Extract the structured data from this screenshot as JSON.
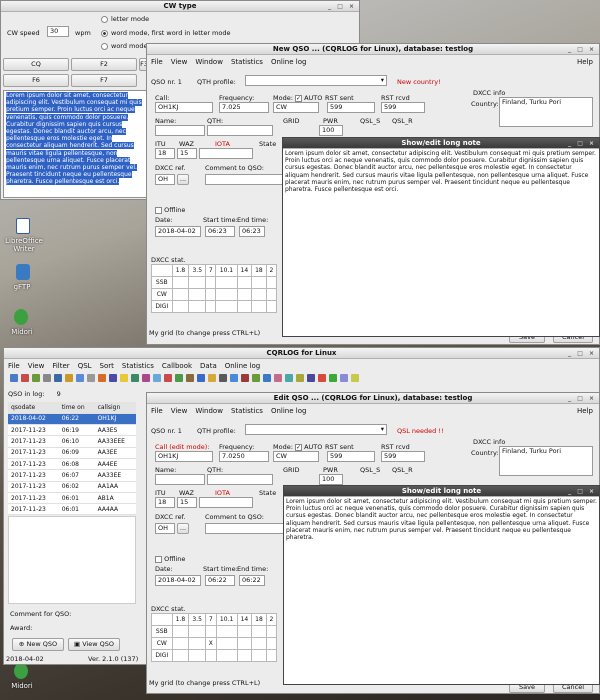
{
  "cwtype": {
    "title": "CW type",
    "speed_label": "CW speed",
    "speed_value": "30",
    "wpm": "wpm",
    "opt1": "letter mode",
    "opt2": "word mode, first word in letter mode",
    "opt3": "word mode",
    "keys": [
      "CQ",
      "F2",
      "F3",
      "F6",
      "F7"
    ],
    "text": "Lorem ipsum dolor sit amet, consectetur adipiscing elit. Vestibulum consequat mi quis pretium semper. Proin luctus orci ac neque venenatis, quis commodo dolor posuere. Curabitur dignissim sapien quis cursus egestas. Donec blandit auctor arcu, nec pellentesque eros molestie eget. In consectetur aliquam hendrerit. Sed cursus mauris vitae ligula pellentesque, non pellentesque urna aliquet. Fusce placerat mauris enim, nec rutrum purus semper vel. Praesent tincidunt neque eu pellentesque pharetra. Fusce pellentesque est orci."
  },
  "desktop": {
    "icons": [
      "LibreOffice Writer",
      "gFTP",
      "Midori",
      "Midori"
    ]
  },
  "newqso": {
    "title": "New QSO ... (CQRLOG for Linux), database: testlog",
    "menu": [
      "File",
      "View",
      "Window",
      "Statistics",
      "Online log",
      "Help"
    ],
    "qso_nr": "QSO nr. 1",
    "qth_profile": "QTH profile:",
    "new_country": "New country!",
    "call_label": "Call:",
    "call": "OH1KJ",
    "freq_label": "Frequency:",
    "freq": "7.025",
    "mode_label": "Mode:",
    "auto": "AUTO",
    "rst_sent_label": "RST sent",
    "rst_rcvd_label": "RST rcvd",
    "mode": "CW",
    "rst_sent": "599",
    "rst_rcvd": "599",
    "name_label": "Name:",
    "qth_label": "QTH:",
    "grid_label": "GRID",
    "pwr_label": "PWR",
    "qsls_label": "QSL_S",
    "qslr_label": "QSL_R",
    "pwr": "100",
    "itu_label": "ITU",
    "waz_label": "WAZ",
    "iota_label": "IOTA",
    "state_label": "State",
    "itu": "18",
    "waz": "15",
    "dxcc_ref_label": "DXCC ref.",
    "comment_label": "Comment to QSO:",
    "dxcc_ref": "OH",
    "offline": "Offline",
    "date_label": "Date:",
    "start_label": "Start time:",
    "end_label": "End time:",
    "date": "2018-04-02",
    "start": "06:23",
    "end": "06:23",
    "dxcc_stat": "DXCC stat.",
    "bands": [
      "1.8",
      "3.5",
      "7",
      "10.1",
      "14",
      "18",
      "2"
    ],
    "rows": [
      "SSB",
      "CW",
      "DIGI"
    ],
    "grid_hint": "My grid (to change press CTRL+L)",
    "dxcc_info_label": "DXCC info",
    "country_label": "Country:",
    "country": "Finland, Turku Pori",
    "save": "Save",
    "cancel": "Cancel"
  },
  "longnote1": {
    "title": "Show/edit long note",
    "text": "Lorem ipsum dolor sit amet, consectetur adipiscing elit. Vestibulum consequat mi quis pretium semper. Proin luctus orci ac neque venenatis, quis commodo dolor posuere. Curabitur dignissim sapien quis cursus egestas. Donec blandit auctor arcu, nec pellentesque eros molestie eget. In consectetur aliquam hendrerit. Sed cursus mauris vitae ligula pellentesque, non pellentesque urna aliquet. Fusce placerat mauris enim, nec rutrum purus semper vel. Praesent tincidunt neque eu pellentesque pharetra. Fusce pellentesque est orci."
  },
  "cqrlog": {
    "title": "CQRLOG for Linux",
    "menu": [
      "File",
      "View",
      "Filter",
      "QSL",
      "Sort",
      "Statistics",
      "Callbook",
      "Data",
      "Online log"
    ],
    "qso_in_log": "QSO in log:",
    "qso_count": "9",
    "columns": [
      "qsodate",
      "time on",
      "callsign"
    ],
    "rows": [
      [
        "2018-04-02",
        "06:22",
        "OH1KJ"
      ],
      [
        "2017-11-23",
        "06:19",
        "AA3ES"
      ],
      [
        "2017-11-23",
        "06:10",
        "AA33EEE"
      ],
      [
        "2017-11-23",
        "06:09",
        "AA3EE"
      ],
      [
        "2017-11-23",
        "06:08",
        "AA4EE"
      ],
      [
        "2017-11-23",
        "06:07",
        "AA33EE"
      ],
      [
        "2017-11-23",
        "06:02",
        "AA1AA"
      ],
      [
        "2017-11-23",
        "06:01",
        "AB1A"
      ],
      [
        "2017-11-23",
        "06:01",
        "AA4AA"
      ]
    ],
    "comment_label": "Comment for QSO:",
    "award_label": "Award:",
    "new_qso": "New QSO",
    "view_qso": "View QSO",
    "status_date": "2018-04-02",
    "version": "Ver. 2.1.0 (137)"
  },
  "editqso": {
    "title": "Edit QSO ... (CQRLOG for Linux), database: testlog",
    "menu": [
      "File",
      "View",
      "Window",
      "Statistics",
      "Online log",
      "Help"
    ],
    "qso_nr": "QSO nr. 1",
    "qth_profile": "QTH profile:",
    "qsl_needed": "QSL needed !!",
    "call_label": "Call (edit mode):",
    "call": "OH1KJ",
    "freq_label": "Frequency:",
    "freq": "7.0250",
    "mode_label": "Mode:",
    "auto": "AUTO",
    "rst_sent_label": "RST sent",
    "rst_rcvd_label": "RST rcvd",
    "mode": "CW",
    "rst_sent": "599",
    "rst_rcvd": "599",
    "name_label": "Name:",
    "qth_label": "QTH:",
    "grid_label": "GRID",
    "pwr_label": "PWR",
    "qsls_label": "QSL_S",
    "qslr_label": "QSL_R",
    "pwr": "100",
    "itu_label": "ITU",
    "waz_label": "WAZ",
    "iota_label": "IOTA",
    "state_label": "State",
    "itu": "18",
    "waz": "15",
    "dxcc_ref_label": "DXCC ref.",
    "comment_label": "Comment to QSO:",
    "dxcc_ref": "OH",
    "offline": "Offline",
    "date_label": "Date:",
    "start_label": "Start time:",
    "end_label": "End time:",
    "date": "2018-04-02",
    "start": "06:22",
    "end": "06:22",
    "dxcc_stat": "DXCC stat.",
    "bands": [
      "1.8",
      "3.5",
      "7",
      "10.1",
      "14",
      "18",
      "2"
    ],
    "rows": [
      "SSB",
      "CW",
      "DIGI"
    ],
    "cw_mark": "X",
    "grid_hint": "My grid (to change press CTRL+L)",
    "dxcc_info_label": "DXCC info",
    "country_label": "Country:",
    "country": "Finland, Turku Pori",
    "save": "Save",
    "cancel": "Cancel"
  },
  "longnote2": {
    "title": "Show/edit long note",
    "text": "Lorem ipsum dolor sit amet, consectetur adipiscing elit. Vestibulum consequat mi quis pretium semper. Proin luctus orci ac neque venenatis, quis commodo dolor posuere. Curabitur dignissim sapien quis cursus egestas. Donec blandit auctor arcu, nec pellentesque eros molestie eget. In consectetur aliquam hendrerit. Sed cursus mauris vitae ligula pellentesque, non pellentesque urna aliquet. Fusce placerat mauris enim, nec rutrum purus semper vel. Praesent tincidunt neque eu pellentesque pharetra."
  }
}
